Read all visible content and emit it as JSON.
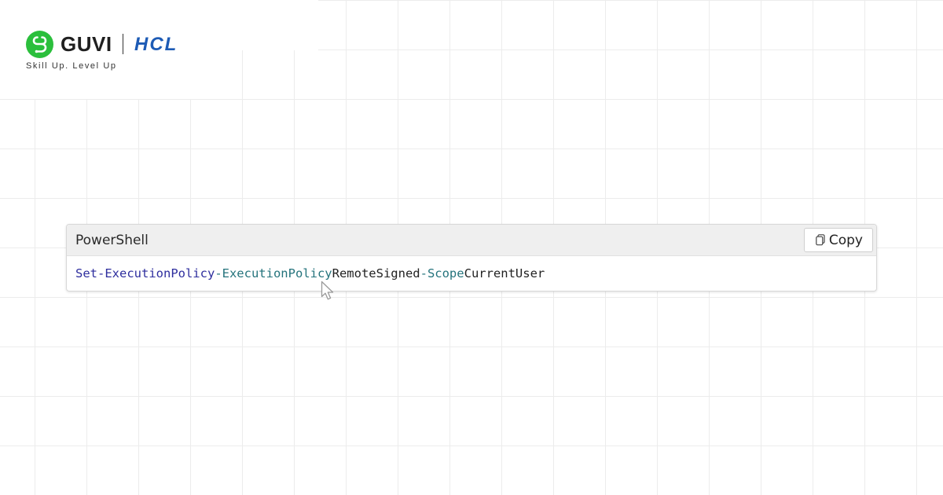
{
  "brand": {
    "guvi_name": "GUVI",
    "hcl_name": "HCL",
    "tagline": "Skill Up. Level Up",
    "icons": {
      "guvi": "guvi-logo-icon",
      "hcl": "hcl-logo-icon"
    },
    "colors": {
      "guvi_green": "#2bbf3c",
      "hcl_blue": "#1d5bb5"
    }
  },
  "code_block": {
    "language": "PowerShell",
    "copy_label": "Copy",
    "copy_icon": "copy-icon",
    "tokens": {
      "command": "Set-ExecutionPolicy",
      "param1": "-ExecutionPolicy",
      "value1": "RemoteSigned",
      "param2": "-Scope",
      "value2": "CurrentUser"
    },
    "colors": {
      "command": "#2e2e9e",
      "parameter": "#24737c",
      "argument": "#222222"
    }
  },
  "cursor": {
    "icon": "mouse-pointer-icon"
  }
}
